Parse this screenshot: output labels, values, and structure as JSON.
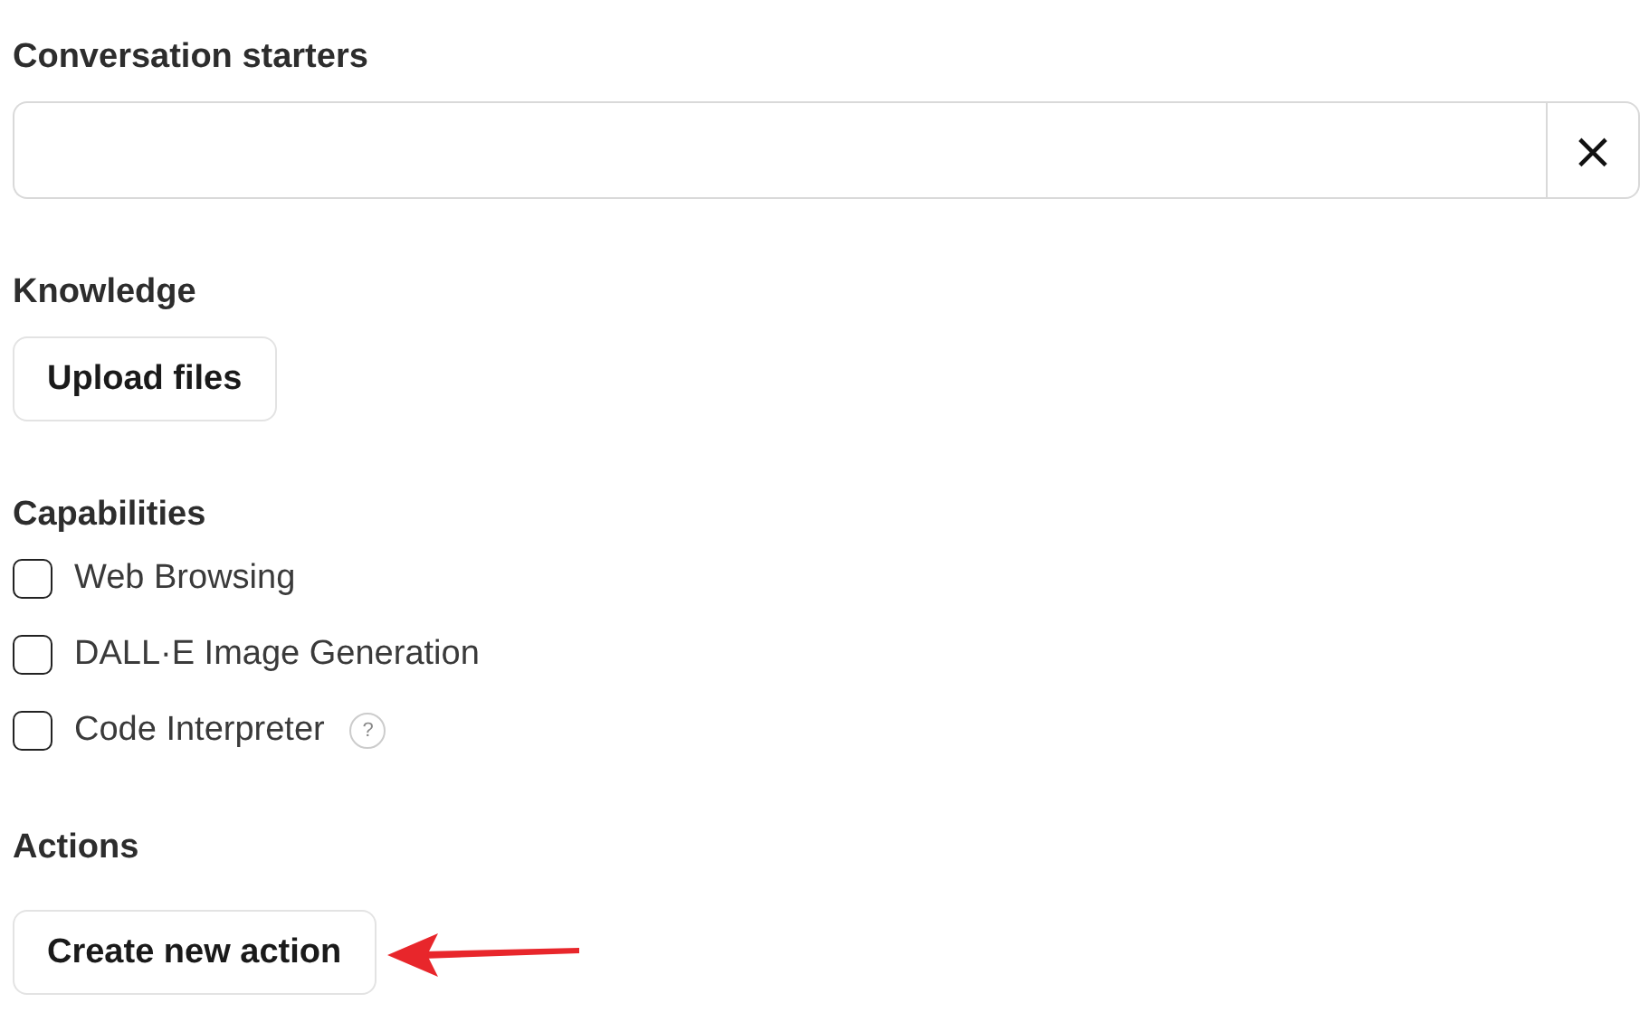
{
  "conversation_starters": {
    "label": "Conversation starters",
    "clear_icon": "×"
  },
  "knowledge": {
    "label": "Knowledge",
    "button": "Upload files"
  },
  "capabilities": {
    "label": "Capabilities",
    "items": [
      {
        "label": "Web Browsing",
        "checked": false
      },
      {
        "label": "DALL·E Image Generation",
        "checked": false
      },
      {
        "label": "Code Interpreter",
        "checked": false,
        "help": "?"
      }
    ]
  },
  "actions": {
    "label": "Actions",
    "button": "Create new action"
  }
}
